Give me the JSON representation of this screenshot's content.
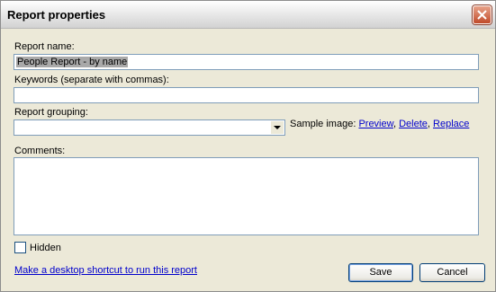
{
  "window": {
    "title": "Report properties"
  },
  "form": {
    "report_name_label": "Report name:",
    "report_name_value": "People Report - by name",
    "keywords_label": "Keywords (separate with commas):",
    "keywords_value": "",
    "grouping_label": "Report grouping:",
    "grouping_value": "",
    "sample_image_label": "Sample image:",
    "preview_link": "Preview",
    "delete_link": "Delete",
    "replace_link": "Replace",
    "comments_label": "Comments:",
    "comments_value": "",
    "hidden_label": "Hidden",
    "hidden_checked": false,
    "shortcut_link": "Make a desktop shortcut to run this report"
  },
  "buttons": {
    "save": "Save",
    "cancel": "Cancel"
  }
}
